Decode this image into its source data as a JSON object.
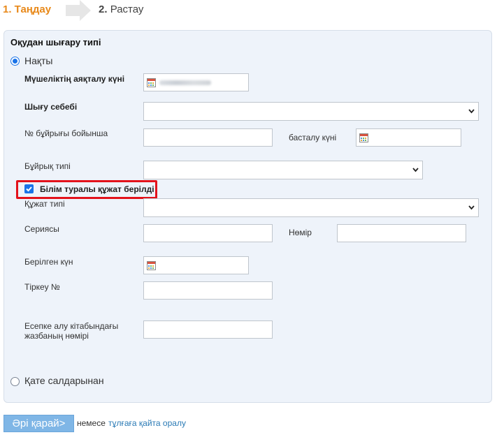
{
  "steps": {
    "step1_label": "1. Таңдау",
    "step2_num": "2.",
    "step2_label": "Растау"
  },
  "form": {
    "title": "Оқудан шығару типі",
    "option_exact": "Нақты",
    "membership_end_label": "Мүшеліктің аяқталу күні",
    "exit_reason_label": "Шығу себебі",
    "order_number_label": "№ бұйрығы бойынша",
    "start_date_label": "басталу күні",
    "order_type_label": "Бұйрық типі",
    "doc_issued_label": "Білім туралы құжат берілді",
    "doc_type_label": "Құжат типі",
    "series_label": "Сериясы",
    "number_label": "Нөмір",
    "issued_date_label": "Берілген күн",
    "registration_label": "Тіркеу №",
    "record_book_label_line1": "Есепке алу кітабындағы",
    "record_book_label_line2": "жазбаның нөмірі",
    "option_mistake": "Қате салдарынан"
  },
  "footer": {
    "next_button": "Әрі қарай>",
    "or_text": "немесе",
    "back_link": "тұлғаға қайта оралу"
  },
  "colors": {
    "step_active": "#e8891a",
    "panel_bg": "#eef3fa",
    "highlight_frame": "#e3121b",
    "accent": "#1a73e8",
    "link": "#2a7ab5"
  }
}
